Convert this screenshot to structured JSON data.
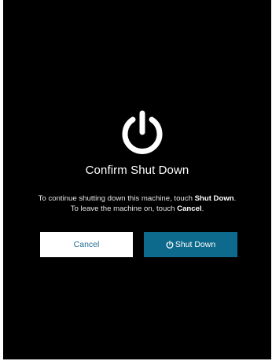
{
  "dialog": {
    "title": "Confirm Shut Down",
    "message": {
      "part1": "To continue shutting down this machine, touch ",
      "bold1": "Shut Down",
      "part2": ". To leave the machine on, touch ",
      "bold2": "Cancel",
      "part3": "."
    },
    "icon": "power-icon"
  },
  "buttons": {
    "cancel_label": "Cancel",
    "shutdown_label": "Shut Down",
    "shutdown_icon": "power-icon"
  },
  "colors": {
    "background": "#000000",
    "primary": "#0e6a8c",
    "cancel_text": "#1f6e92"
  }
}
